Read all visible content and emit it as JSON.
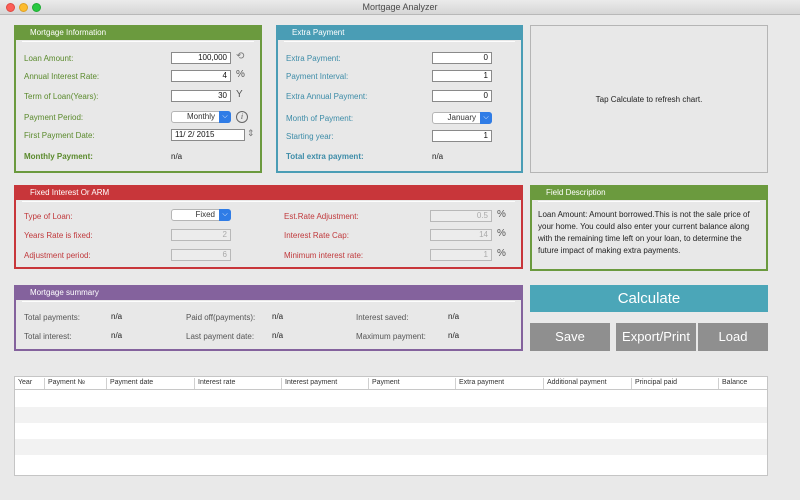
{
  "window": {
    "title": "Mortgage Analyzer"
  },
  "mortgage_info": {
    "title": "Mortgage Information",
    "loan_amount_label": "Loan Amount:",
    "loan_amount": "100,000",
    "interest_label": "Annual Interest Rate:",
    "interest": "4",
    "interest_unit": "%",
    "term_label": "Term of Loan(Years):",
    "term": "30",
    "term_unit": "Y",
    "period_label": "Payment Period:",
    "period": "Monthly",
    "first_payment_label": "First Payment Date:",
    "first_payment": "11/  2/ 2015",
    "monthly_payment_label": "Monthly Payment:",
    "monthly_payment": "n/a"
  },
  "extra_payment": {
    "title": "Extra Payment",
    "extra_label": "Extra Payment:",
    "extra": "0",
    "interval_label": "Payment Interval:",
    "interval": "1",
    "annual_label": "Extra Annual Payment:",
    "annual": "0",
    "month_label": "Month of Payment:",
    "month": "January",
    "start_year_label": "Starting year:",
    "start_year": "1",
    "total_label": "Total extra payment:",
    "total": "n/a"
  },
  "chart": {
    "message": "Tap Calculate to refresh chart."
  },
  "arm": {
    "title": "Fixed Interest Or ARM",
    "type_label": "Type of Loan:",
    "type": "Fixed",
    "years_fixed_label": "Years Rate is fixed:",
    "years_fixed": "2",
    "adj_period_label": "Adjustment period:",
    "adj_period": "6",
    "est_adj_label": "Est.Rate Adjustment:",
    "est_adj": "0.5",
    "rate_cap_label": "Interest Rate Cap:",
    "rate_cap": "14",
    "min_rate_label": "Minimum interest rate:",
    "min_rate": "1",
    "pct": "%"
  },
  "field_desc": {
    "title": "Field Description",
    "text": "Loan Amount: Amount borrowed.This is not the sale price of your home.  You could also enter your current balance along with the remaining time left on your loan, to determine the future impact of making extra payments."
  },
  "summary": {
    "title": "Mortgage summary",
    "total_payments_label": "Total payments:",
    "total_payments": "n/a",
    "total_interest_label": "Total interest:",
    "total_interest": "n/a",
    "paid_off_label": "Paid off(payments):",
    "paid_off": "n/a",
    "last_payment_label": "Last payment date:",
    "last_payment": "n/a",
    "interest_saved_label": "Interest saved:",
    "interest_saved": "n/a",
    "max_payment_label": "Maximum payment:",
    "max_payment": "n/a"
  },
  "buttons": {
    "calculate": "Calculate",
    "save": "Save",
    "export": "Export/Print",
    "load": "Load"
  },
  "table": {
    "columns": [
      "Year",
      "Payment №",
      "Payment date",
      "Interest rate",
      "Interest payment",
      "Payment",
      "Extra payment",
      "Additional payment",
      "Principal paid",
      "Balance"
    ]
  }
}
